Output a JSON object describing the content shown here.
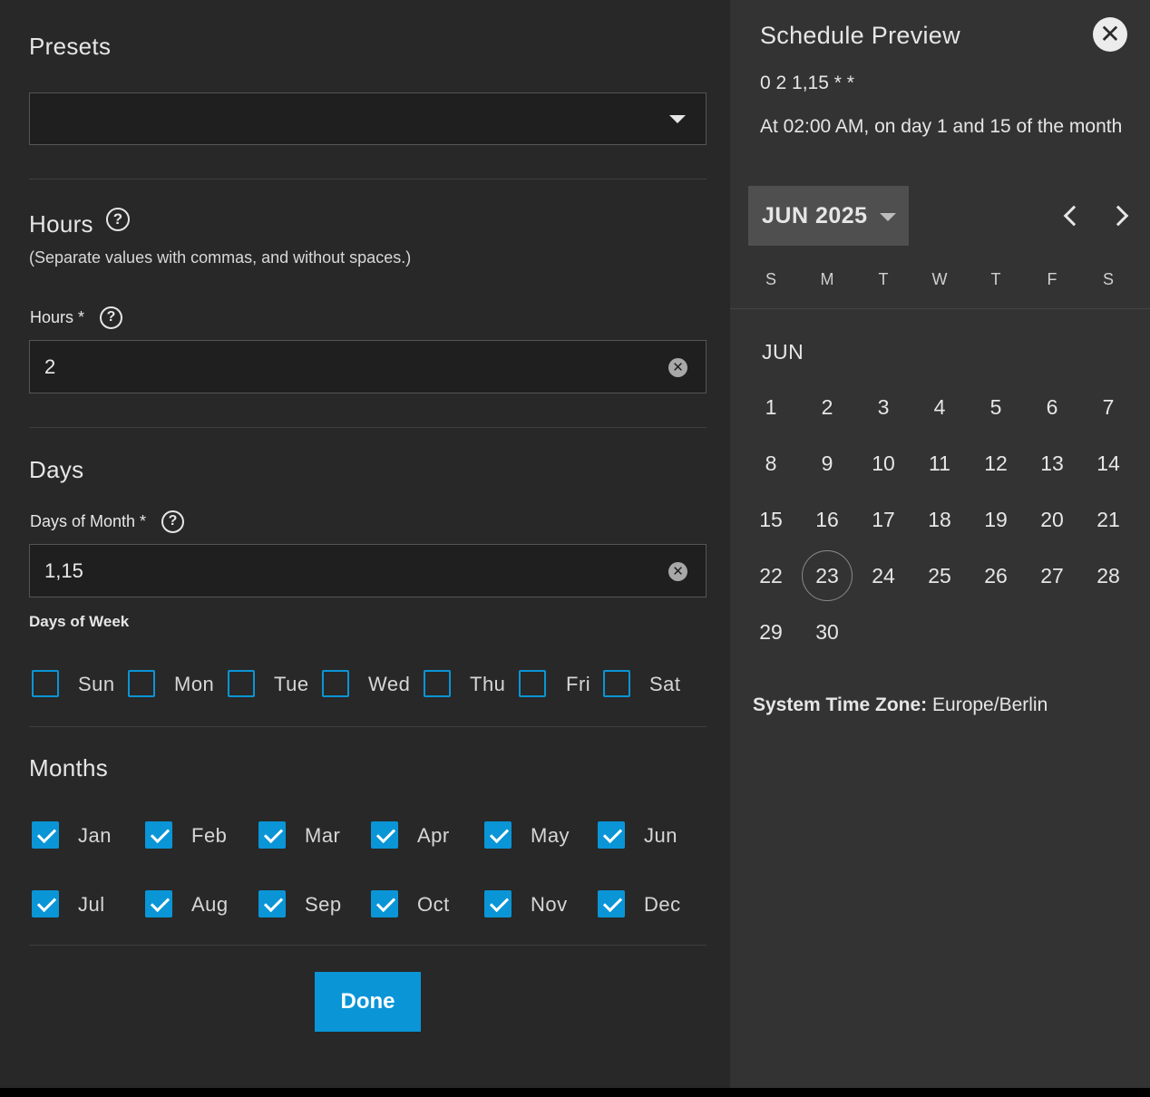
{
  "form": {
    "presets": {
      "title": "Presets",
      "value": ""
    },
    "hours": {
      "title": "Hours",
      "hint": "(Separate values with commas, and without spaces.)",
      "label": "Hours *",
      "value": "2"
    },
    "days": {
      "title": "Days",
      "dom_label": "Days of Month *",
      "dom_value": "1,15",
      "dow_label": "Days of Week",
      "weekdays": [
        {
          "label": "Sun",
          "checked": false
        },
        {
          "label": "Mon",
          "checked": false
        },
        {
          "label": "Tue",
          "checked": false
        },
        {
          "label": "Wed",
          "checked": false
        },
        {
          "label": "Thu",
          "checked": false
        },
        {
          "label": "Fri",
          "checked": false
        },
        {
          "label": "Sat",
          "checked": false
        }
      ]
    },
    "months": {
      "title": "Months",
      "items": [
        {
          "label": "Jan",
          "checked": true
        },
        {
          "label": "Feb",
          "checked": true
        },
        {
          "label": "Mar",
          "checked": true
        },
        {
          "label": "Apr",
          "checked": true
        },
        {
          "label": "May",
          "checked": true
        },
        {
          "label": "Jun",
          "checked": true
        },
        {
          "label": "Jul",
          "checked": true
        },
        {
          "label": "Aug",
          "checked": true
        },
        {
          "label": "Sep",
          "checked": true
        },
        {
          "label": "Oct",
          "checked": true
        },
        {
          "label": "Nov",
          "checked": true
        },
        {
          "label": "Dec",
          "checked": true
        }
      ]
    },
    "done_label": "Done"
  },
  "preview": {
    "title": "Schedule Preview",
    "close_glyph": "✕",
    "cron": "0 2 1,15 * *",
    "description": "At 02:00 AM, on day 1 and 15 of the month",
    "month_button": "JUN 2025",
    "weekday_headers": [
      "S",
      "M",
      "T",
      "W",
      "T",
      "F",
      "S"
    ],
    "calendar_month_label": "JUN",
    "days": [
      1,
      2,
      3,
      4,
      5,
      6,
      7,
      8,
      9,
      10,
      11,
      12,
      13,
      14,
      15,
      16,
      17,
      18,
      19,
      20,
      21,
      22,
      23,
      24,
      25,
      26,
      27,
      28,
      29,
      30
    ],
    "first_weekday_index": 0,
    "today": 23,
    "timezone_label": "System Time Zone:",
    "timezone_value": "Europe/Berlin"
  },
  "icons": {
    "help": "?",
    "clear": "✕"
  },
  "colors": {
    "accent": "#0a95d6",
    "panel_left": "#282828",
    "panel_right": "#333333"
  }
}
